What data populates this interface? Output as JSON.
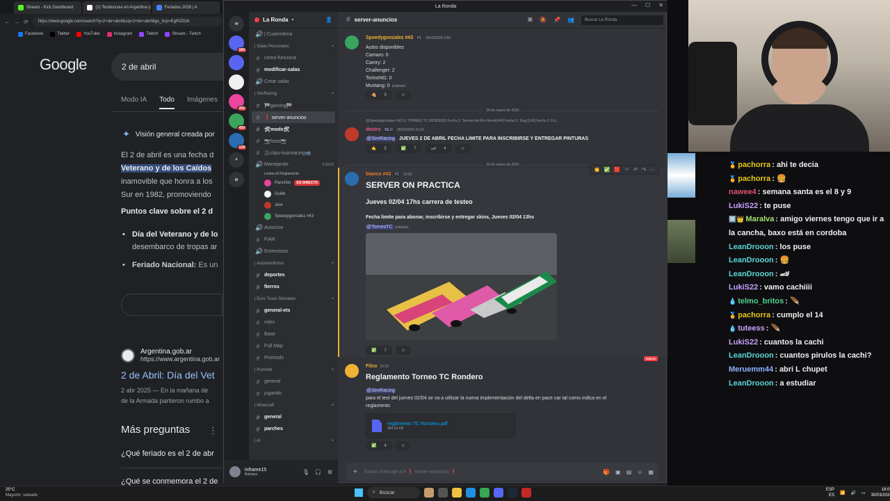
{
  "browser": {
    "tabs": [
      {
        "label": "Stream - Kick Dashboard",
        "color": "#53fc18"
      },
      {
        "label": "(1) Tendencias en Argentina (@pc",
        "color": "#ffffff"
      },
      {
        "label": "Feriados 2026 | A",
        "color": "#4285f4"
      }
    ],
    "url": "https://www.google.com/search?q=2+de+abril&oq=2+de+abril&gs_lcrp=EgRIZGdl",
    "bookmarks": [
      {
        "label": "Facebook",
        "color": "#1877f2"
      },
      {
        "label": "Twitter",
        "color": "#000000"
      },
      {
        "label": "YouTube",
        "color": "#ff0000"
      },
      {
        "label": "Instagram",
        "color": "#e1306c"
      },
      {
        "label": "Twitch",
        "color": "#9146ff"
      },
      {
        "label": "Stream - Twitch",
        "color": "#9146ff"
      }
    ]
  },
  "google": {
    "logo": "Google",
    "query": "2 de abril",
    "tabs": [
      "Modo IA",
      "Todo",
      "Imágenes"
    ],
    "active_tab": "Todo",
    "ai_overview_title": "Visión general creada por",
    "ai_line1": "El 2 de abril es una fecha d",
    "ai_line2_hl": "Veterano y de los Caídos",
    "ai_line3": "inamovible que honra a los",
    "ai_line4": "Sur en 1982, promoviendo",
    "points_title": "Puntos clave sobre el 2 d",
    "bullet1_bold": "Día del Veterano y de lo",
    "bullet1_rest": "desembarco de tropas ar",
    "bullet2_bold": "Feriado Nacional:",
    "bullet2_rest": " Es un",
    "site_name": "Argentina.gob.ar",
    "site_url": "https://www.argentina.gob.ar",
    "result_title": "2 de Abril: Día del Vet",
    "snippet1": "2 abr 2025 — En la mañana de",
    "snippet2": "de la Armada partieron rumbo a",
    "more_questions": "Más preguntas",
    "q1": "¿Qué feriado es el 2 de abr",
    "q2": "¿Qué se conmemora el 2 de"
  },
  "discord": {
    "window_title": "La Ronda",
    "server_name": "La Ronda",
    "servers": [
      {
        "badge": "184",
        "color": "#5865f2"
      },
      {
        "badge": "",
        "color": "#5865f2"
      },
      {
        "badge": "",
        "color": "#f0f0f0"
      },
      {
        "badge": "392",
        "color": "#eb459e"
      },
      {
        "badge": "420",
        "color": "#3ba55d"
      },
      {
        "badge": "128",
        "color": "#2b6cb0"
      }
    ],
    "channel_items": [
      {
        "type": "ch",
        "icon": "🔊",
        "label": "| Cuarentena"
      },
      {
        "type": "cat",
        "label": "| Salas Personales"
      },
      {
        "type": "ch",
        "icon": "#",
        "label": "como-funciona"
      },
      {
        "type": "ch",
        "icon": "#",
        "label": "modificar-salas",
        "unread": true
      },
      {
        "type": "ch",
        "icon": "🔊",
        "label": "Crear salas"
      },
      {
        "type": "cat",
        "label": "| SimRacing"
      },
      {
        "type": "ch",
        "icon": "#",
        "label": "🏁gaming🏁"
      },
      {
        "type": "ch",
        "icon": "#",
        "label": "❗ server-anuncios",
        "selected": true
      },
      {
        "type": "ch",
        "icon": "#",
        "label": "🛠mods🛠",
        "unread": true
      },
      {
        "type": "ch",
        "icon": "#",
        "label": "📷fotos📷"
      },
      {
        "type": "ch",
        "icon": "#",
        "label": "🎥clips-lrsimracing📹"
      },
      {
        "type": "ch",
        "icon": "🔊",
        "label": "Manejando"
      },
      {
        "type": "ch",
        "icon": "🔊",
        "label": "Autocine"
      },
      {
        "type": "ch",
        "icon": "#",
        "label": "FIAR"
      },
      {
        "type": "ch",
        "icon": "🔊",
        "label": "Entrevistas"
      },
      {
        "type": "cat",
        "label": "| Automovilismo"
      },
      {
        "type": "ch",
        "icon": "#",
        "label": "deportes",
        "unread": true
      },
      {
        "type": "ch",
        "icon": "#",
        "label": "fierros",
        "unread": true
      },
      {
        "type": "cat",
        "label": "| Euro Truck Simulator"
      },
      {
        "type": "ch",
        "icon": "#",
        "label": "general-ets",
        "unread": true
      },
      {
        "type": "ch",
        "icon": "#",
        "label": "roles"
      },
      {
        "type": "ch",
        "icon": "#",
        "label": "Base"
      },
      {
        "type": "ch",
        "icon": "#",
        "label": "Full Map"
      },
      {
        "type": "ch",
        "icon": "#",
        "label": "Promods"
      },
      {
        "type": "cat",
        "label": "| Pummel"
      },
      {
        "type": "ch",
        "icon": "#",
        "label": "general"
      },
      {
        "type": "ch",
        "icon": "#",
        "label": "jugando"
      },
      {
        "type": "cat",
        "label": "| Minecraft"
      },
      {
        "type": "ch",
        "icon": "#",
        "label": "general",
        "unread": true
      },
      {
        "type": "ch",
        "icon": "#",
        "label": "parches",
        "unread": true
      },
      {
        "type": "cat",
        "label": "| AI"
      }
    ],
    "voice_time": "0:10:02",
    "voice_subtitle": "Leistos El Reglamento",
    "voice_users": [
      {
        "name": "Panchito",
        "live": "EN DIRECTO",
        "color": "#eb459e"
      },
      {
        "name": "Guille",
        "live": "",
        "color": "#f2f3f5"
      },
      {
        "name": "Jere",
        "live": "",
        "color": "#c0392b"
      },
      {
        "name": "Speedygonzalez #43",
        "live": "",
        "color": "#3ba55d"
      }
    ],
    "user": {
      "name": "inframe15",
      "status": "Bahiano"
    },
    "channel_header": "server-anuncios",
    "search_placeholder": "Buscar La Ronda",
    "composer_placeholder": "Enviar mensaje a # ❗ server-anuncios ❗",
    "messages": {
      "m1": {
        "author": "Speedygonzalez #43",
        "tag": "F1",
        "time": "26/03/2026 0:50",
        "lines": [
          "Autos disponibles",
          "Camaro: 0",
          "Camry: 2",
          "Challenger: 2",
          "TorinoNG: 0",
          "Mustang: 0"
        ],
        "edited": "(editado)",
        "reactions": [
          {
            "e": "🐴",
            "n": "5"
          },
          {
            "e": "☺",
            "n": ""
          }
        ]
      },
      "div1": "28 de marzo de 2026",
      "m2": {
        "reply": "@Speedygonzalez #43  F1  TORNEO TC RONDERO   Fecha 1: Termas del Río Hondo(4/4)   Fecha 2: Toay(11/4)   Fecha 3: 9 d...",
        "author": "destro",
        "tag": "BILO",
        "time": "28/03/2026 21:03",
        "mention": "@SimRacing",
        "text": "JUEVES 2 DE ABRIL FECHA LIMITE PARA INSCRIBIRSE Y ENTREGAR PINTURAS",
        "reactions": [
          {
            "e": "🤙",
            "n": "5"
          },
          {
            "e": "✅",
            "n": "7"
          },
          {
            "e": "🏎",
            "n": "4"
          },
          {
            "e": "☺",
            "n": ""
          }
        ]
      },
      "div2": "30 de marzo de 2026",
      "m3": {
        "author": "bianco #43",
        "tag": "F1",
        "time": "14:03",
        "title": "SERVER ON PRACTICA",
        "subtitle": "Jueves 02/04 17hs carrera de testeo",
        "detail": "Fecha limite para abonar, inscribirse y entregar skins, Jueves 02/04 13hs",
        "mention": "@TorneoTC",
        "edited": "(editado)",
        "reactions": [
          {
            "e": "✅",
            "n": "7"
          },
          {
            "e": "☺",
            "n": ""
          }
        ]
      },
      "new_badge": "NUEVO",
      "m4": {
        "author": "Filco",
        "time": "15:29",
        "title": "Reglamento Torneo TC Rondero",
        "mention": "@SimRacing",
        "text1": "para el test del jueves 02/04 se va a utilizar la nueva implementación del delta en pace car tal como indica en el",
        "text2": "reglamento",
        "file_name": "reglamento TC Rondero.pdf",
        "file_size": "484.03 KB",
        "reactions": [
          {
            "e": "✅",
            "n": "4"
          },
          {
            "e": "☺",
            "n": ""
          }
        ]
      }
    }
  },
  "chat": [
    {
      "user": "pachorra",
      "color": "#e6c619",
      "badge": "🏅",
      "text": "ahi te decia"
    },
    {
      "user": "pachorra",
      "color": "#e6c619",
      "badge": "🏅",
      "text": "🍔"
    },
    {
      "user": "nawee4",
      "color": "#e0506a",
      "badge": "",
      "text": "semana santa es el 8 y 9"
    },
    {
      "user": "LukiS22",
      "color": "#c9a0ff",
      "badge": "",
      "text": "te puse"
    },
    {
      "user": "Maralva",
      "color": "#a0e06a",
      "badge": "🔟👑",
      "text": "amigo viernes tengo que ir a la cancha, baxo está en cordoba"
    },
    {
      "user": "LeanDrooon",
      "color": "#5bd6d6",
      "badge": "",
      "text": "los puse"
    },
    {
      "user": "LeanDrooon",
      "color": "#5bd6d6",
      "badge": "",
      "text": "🍔"
    },
    {
      "user": "LeanDrooon",
      "color": "#5bd6d6",
      "badge": "",
      "text": "🏎"
    },
    {
      "user": "LukiS22",
      "color": "#c9a0ff",
      "badge": "",
      "text": "vamo cachiiii"
    },
    {
      "user": "telmo_britos",
      "color": "#4ed38f",
      "badge": "💧",
      "text": "🪶"
    },
    {
      "user": "pachorra",
      "color": "#e6c619",
      "badge": "🏅",
      "text": "cumplo el 14"
    },
    {
      "user": "tuteess",
      "color": "#c9a0ff",
      "badge": "💧",
      "text": "🪶"
    },
    {
      "user": "LukiS22",
      "color": "#c9a0ff",
      "badge": "",
      "text": "cuantos la cachi"
    },
    {
      "user": "LeanDrooon",
      "color": "#5bd6d6",
      "badge": "",
      "text": "cuantos pirulos la cachi?"
    },
    {
      "user": "Meruemm44",
      "color": "#8fb4ff",
      "badge": "",
      "text": "abri L chupet"
    },
    {
      "user": "LeanDrooon",
      "color": "#5bd6d6",
      "badge": "",
      "text": "a estudiar"
    }
  ],
  "taskbar": {
    "temp": "25°C",
    "weather": "Mayorm. soleado",
    "search": "Buscar",
    "lang1": "ESP",
    "lang2": "ES",
    "time": "18:09",
    "date": "30/03/2026"
  }
}
